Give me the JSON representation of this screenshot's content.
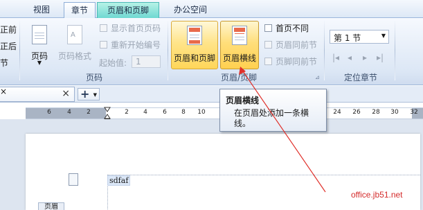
{
  "tabs": {
    "view": "视图",
    "section": "章节",
    "header_footer": "页眉和页脚",
    "office_space": "办公空间"
  },
  "left_partial": [
    "正前",
    "正后",
    "节"
  ],
  "page_number_group": {
    "page_number": "页码",
    "page_number_format": "页码格式",
    "show_first_page_number": "显示首页页码",
    "restart_numbering": "重新开始编号",
    "start_value_label": "起始值:",
    "start_value": "1",
    "group_label": "页码"
  },
  "header_footer_group": {
    "header_footer_button": "页眉和页脚",
    "header_line_button": "页眉横线",
    "different_first_page": "首页不同",
    "header_same_as_previous": "页眉同前节",
    "footer_same_as_previous": "页脚同前节",
    "group_label": "页眉/页脚"
  },
  "section_nav_group": {
    "section_select": "第 1 节",
    "group_label": "定位章节"
  },
  "tooltip": {
    "title": "页眉横线",
    "description": "在页眉处添加一条横线。"
  },
  "doc_tabs": {
    "close": "×",
    "new": "+"
  },
  "ruler_labels": [
    "6",
    "4",
    "2",
    "2",
    "4",
    "6",
    "8",
    "10",
    "24",
    "26",
    "28",
    "30",
    "32"
  ],
  "document": {
    "header_text": "sdfaf",
    "bottom_label": "页眉"
  },
  "watermark": "office.jb51.net",
  "colors": {
    "highlight": "#ffd659",
    "context_tab": "#6fd8d2",
    "arrow": "#e0302a"
  }
}
